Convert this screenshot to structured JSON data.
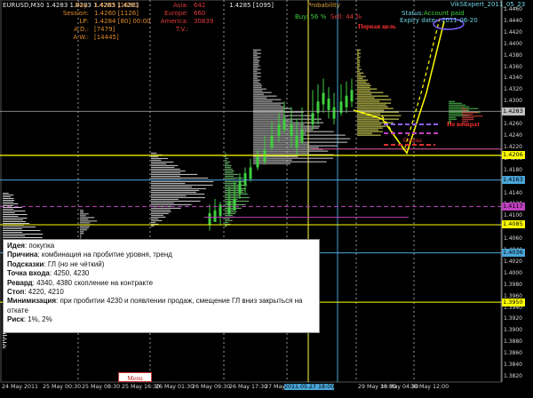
{
  "title_bar": {
    "symbol": "EURUSD,M30",
    "ohlc": "1.4283 1.4283 1.4283 1.4283"
  },
  "stats_left": [
    {
      "label": "Day:",
      "value": "1.4285 [1692]"
    },
    {
      "label": "Session:",
      "value": "1.4260 [1126]"
    },
    {
      "label": "LP:",
      "value": "1.4284 [80] 00:00"
    },
    {
      "label": "A.D.:",
      "value": "[7479]"
    },
    {
      "label": "A.W.:",
      "value": "[14445]"
    }
  ],
  "stats_mid": [
    {
      "label": "Asia:",
      "value": "642"
    },
    {
      "label": "Europe:",
      "value": "660"
    },
    {
      "label": "America:",
      "value": ""
    },
    {
      "label": "T.V.:",
      "value": "30839"
    }
  ],
  "mid_price": "1.4285 [1095]",
  "probability": {
    "label": "Probability",
    "buy": "Buy: 56 %",
    "sell": "Sell: 44 %"
  },
  "status": {
    "expert": "VikSExpert_2011_05_23",
    "status_label": "Status:",
    "status_value": "Account paid",
    "expiry_label": "Expiry date:",
    "expiry_value": "2011-06-20"
  },
  "legend": {
    "first_target": "Первая цель",
    "no_return": "Не возврат",
    "stops": "Стопы"
  },
  "note": {
    "idea_label": "Идея",
    "idea_value": "покупка",
    "reason_label": "Причина",
    "reason_value": "комбинация на пробитие уровня, тренд",
    "hints_label": "Подсказки",
    "hints_value": "ГЛ (но не чёткий)",
    "entry_label": "Точка входа",
    "entry_value": "4250, 4230",
    "reward_label": "Ревард",
    "reward_value": "4340, 4380 скопление на контракте",
    "stop_label": "Стоп",
    "stop_value": "4220, 4210",
    "minim_label": "Минимизация",
    "minim_value": "при пробитии 4230 и появлении продаж, смещение ГЛ вниз закрыться на откате",
    "risk_label": "Риск",
    "risk_value": "1%, 2%"
  },
  "menu_button": "Menu",
  "price_axis": [
    "1.4460",
    "1.4440",
    "1.4420",
    "1.4400",
    "1.4380",
    "1.4360",
    "1.4340",
    "1.4320",
    "1.4300",
    "1.4280",
    "1.4260",
    "1.4240",
    "1.4220",
    "1.4200",
    "1.4180",
    "1.4160",
    "1.4140",
    "1.4120",
    "1.4100",
    "1.4080",
    "1.4060",
    "1.4040",
    "1.4020",
    "1.4000",
    "1.3980",
    "1.3960",
    "1.3940",
    "1.3920",
    "1.3900",
    "1.3880",
    "1.3860",
    "1.3840",
    "1.3820"
  ],
  "price_tags": [
    {
      "value": "1.4283",
      "color": "#c0c0c0"
    },
    {
      "value": "1.4206",
      "color": "#ffff00"
    },
    {
      "value": "1.4163",
      "color": "#49a5d8"
    },
    {
      "value": "1.4117",
      "color": "#c040c0"
    },
    {
      "value": "1.4085",
      "color": "#ffff00"
    },
    {
      "value": "1.4036",
      "color": "#49a5d8"
    },
    {
      "value": "1.3950",
      "color": "#ffff00"
    }
  ],
  "time_axis": [
    "24 May 2011",
    "25 May 00:30",
    "25 May 08:30",
    "25 May 16:30",
    "26 May 01:30",
    "26 May 09:30",
    "26 May 17:30",
    "27 May 02:30",
    "2011.05.27 18:00",
    "29 May 18:30",
    "30 May 04:30",
    "30 May 12:00"
  ],
  "colors": {
    "accent_yellow": "#ffff00",
    "level_blue": "#49a5d8",
    "level_magenta": "#c040c0",
    "candle_green": "#3fcf3f",
    "profile_white": "#d0d0d0"
  }
}
